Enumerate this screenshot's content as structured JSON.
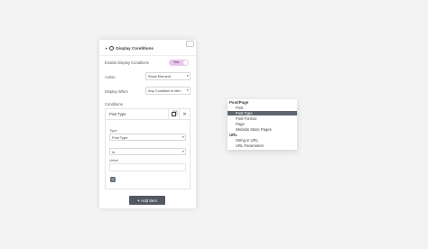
{
  "panel": {
    "title": "Display Conditions",
    "enable_label": "Enable Display Conditions",
    "enable_toggle": "Yes",
    "action_label": "Action",
    "action_value": "Show Element",
    "display_when_label": "Display When",
    "display_when_value": "Any Condition is Met",
    "conditions_label": "Conditions",
    "condition": {
      "title": "Post Type",
      "type_label": "Type",
      "type_value": "Post Type",
      "operator_value": "Is",
      "value_label": "Value",
      "value_tag": "×"
    },
    "add_item_label": "Add Item"
  },
  "popup": {
    "groups": [
      {
        "label": "Post/Page",
        "options": [
          "Post",
          "Post Type",
          "Post Format",
          "Page",
          "Website Static Pages"
        ]
      },
      {
        "label": "URL",
        "options": [
          "String in URL",
          "URL Parameters"
        ]
      }
    ],
    "selected": "Post Type"
  },
  "colors": {
    "toggle_bg": "#e7c7ea",
    "button_bg": "#525962",
    "selected_bg": "#5e6670"
  }
}
